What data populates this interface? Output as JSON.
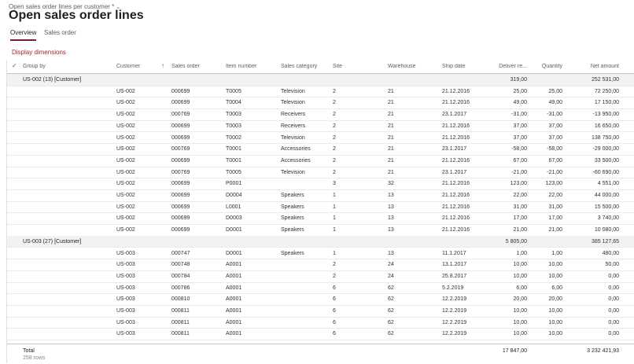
{
  "header": {
    "view_name": "Open sales order lines per customer *",
    "view_chevron": "⌄",
    "title": "Open sales order lines"
  },
  "tabs": [
    {
      "label": "Overview",
      "selected": true
    },
    {
      "label": "Sales order",
      "selected": false
    }
  ],
  "display_dimensions": "Display dimensions",
  "columns": {
    "group_by": "Group by",
    "customer": "Customer",
    "sales_order": "Sales order",
    "item_number": "Item number",
    "sales_category": "Sales category",
    "site": "Site",
    "warehouse": "Warehouse",
    "ship_date": "Ship date",
    "deliver_remainder": "Deliver re...",
    "quantity": "Quantity",
    "net_amount": "Net amount"
  },
  "groups": [
    {
      "label": "US-002 (13) [Customer]",
      "deliver_total": "319,00",
      "net_total": "252 531,00",
      "rows": [
        [
          "US-002",
          "000699",
          "T0005",
          "Television",
          "2",
          "21",
          "21.12.2016",
          "25,00",
          "25,00",
          "72 250,00"
        ],
        [
          "US-002",
          "000699",
          "T0004",
          "Television",
          "2",
          "21",
          "21.12.2016",
          "49,00",
          "49,00",
          "17 150,00"
        ],
        [
          "US-002",
          "000769",
          "T0003",
          "Receivers",
          "2",
          "21",
          "23.1.2017",
          "-31,00",
          "-31,00",
          "-13 950,00"
        ],
        [
          "US-002",
          "000699",
          "T0003",
          "Receivers",
          "2",
          "21",
          "21.12.2016",
          "37,00",
          "37,00",
          "16 650,00"
        ],
        [
          "US-002",
          "000699",
          "T0002",
          "Television",
          "2",
          "21",
          "21.12.2016",
          "37,00",
          "37,00",
          "138 750,00"
        ],
        [
          "US-002",
          "000769",
          "T0001",
          "Accessories",
          "2",
          "21",
          "23.1.2017",
          "-58,00",
          "-58,00",
          "-29 000,00"
        ],
        [
          "US-002",
          "000699",
          "T0001",
          "Accessories",
          "2",
          "21",
          "21.12.2016",
          "67,00",
          "67,00",
          "33 500,00"
        ],
        [
          "US-002",
          "000769",
          "T0005",
          "Television",
          "2",
          "21",
          "23.1.2017",
          "-21,00",
          "-21,00",
          "-60 690,00"
        ],
        [
          "US-002",
          "000699",
          "P0001",
          "",
          "3",
          "32",
          "21.12.2016",
          "123,00",
          "123,00",
          "4 551,00"
        ],
        [
          "US-002",
          "000699",
          "D0004",
          "Speakers",
          "1",
          "13",
          "21.12.2016",
          "22,00",
          "22,00",
          "44 000,00"
        ],
        [
          "US-002",
          "000699",
          "L0001",
          "Speakers",
          "1",
          "13",
          "21.12.2016",
          "31,00",
          "31,00",
          "15 500,00"
        ],
        [
          "US-002",
          "000699",
          "D0003",
          "Speakers",
          "1",
          "13",
          "21.12.2016",
          "17,00",
          "17,00",
          "3 740,00"
        ],
        [
          "US-002",
          "000699",
          "D0001",
          "Speakers",
          "1",
          "13",
          "21.12.2016",
          "21,00",
          "21,00",
          "10 080,00"
        ]
      ]
    },
    {
      "label": "US-003 (27) [Customer]",
      "deliver_total": "5 805,00",
      "net_total": "385 127,65",
      "rows": [
        [
          "US-003",
          "000747",
          "D0001",
          "Speakers",
          "1",
          "13",
          "11.1.2017",
          "1,00",
          "1,00",
          "480,00"
        ],
        [
          "US-003",
          "000748",
          "A0001",
          "",
          "2",
          "24",
          "13.1.2017",
          "10,00",
          "10,00",
          "50,00"
        ],
        [
          "US-003",
          "000784",
          "A0001",
          "",
          "2",
          "24",
          "25.8.2017",
          "10,00",
          "10,00",
          "0,00"
        ],
        [
          "US-003",
          "000786",
          "A0001",
          "",
          "6",
          "62",
          "5.2.2019",
          "6,00",
          "6,00",
          "0,00"
        ],
        [
          "US-003",
          "000810",
          "A0001",
          "",
          "6",
          "62",
          "12.2.2019",
          "20,00",
          "20,00",
          "0,00"
        ],
        [
          "US-003",
          "000811",
          "A0001",
          "",
          "6",
          "62",
          "12.2.2019",
          "10,00",
          "10,00",
          "0,00"
        ],
        [
          "US-003",
          "000811",
          "A0001",
          "",
          "6",
          "62",
          "12.2.2019",
          "10,00",
          "10,00",
          "0,00"
        ],
        [
          "US-003",
          "000811",
          "A0001",
          "",
          "6",
          "62",
          "12.2.2019",
          "10,00",
          "10,00",
          "0,00"
        ]
      ]
    }
  ],
  "total": {
    "label": "Total",
    "rows": "258 rows",
    "deliver": "17 847,00",
    "net": "3 232 421,93"
  }
}
